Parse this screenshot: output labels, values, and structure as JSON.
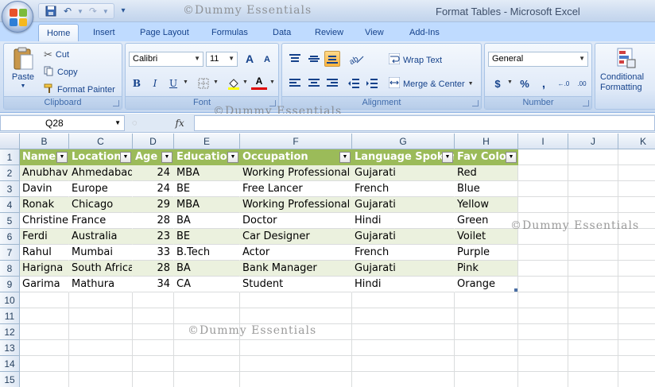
{
  "window": {
    "title": "Format Tables - Microsoft Excel"
  },
  "watermark": "©Dummy Essentials",
  "tabs": [
    "Home",
    "Insert",
    "Page Layout",
    "Formulas",
    "Data",
    "Review",
    "View",
    "Add-Ins"
  ],
  "clipboard": {
    "paste": "Paste",
    "cut": "Cut",
    "copy": "Copy",
    "format_painter": "Format Painter",
    "label": "Clipboard"
  },
  "font": {
    "name": "Calibri",
    "size": "11",
    "bold": "B",
    "italic": "I",
    "underline": "U",
    "grow": "A",
    "shrink": "A",
    "font_color": "A",
    "label": "Font"
  },
  "alignment": {
    "wrap_text": "Wrap Text",
    "merge_center": "Merge & Center",
    "label": "Alignment"
  },
  "number": {
    "format": "General",
    "currency": "$",
    "percent": "%",
    "comma": ",",
    "label": "Number"
  },
  "styles": {
    "conditional_formatting_1": "Conditional",
    "conditional_formatting_2": "Formatting"
  },
  "formula_bar": {
    "name_box": "Q28",
    "fx": "fx",
    "formula": ""
  },
  "columns": [
    "B",
    "C",
    "D",
    "E",
    "F",
    "G",
    "H",
    "I",
    "J",
    "K"
  ],
  "rows": [
    "1",
    "2",
    "3",
    "4",
    "5",
    "6",
    "7",
    "8",
    "9",
    "10",
    "11",
    "12",
    "13",
    "14",
    "15"
  ],
  "table": {
    "headers": [
      "Name",
      "Location",
      "Age",
      "Education",
      "Occupation",
      "Language Spoken",
      "Fav Color"
    ],
    "rows": [
      [
        "Anubhav",
        "Ahmedabad",
        "24",
        "MBA",
        "Working Professional",
        "Gujarati",
        "Red"
      ],
      [
        "Davin",
        "Europe",
        "24",
        "BE",
        "Free Lancer",
        "French",
        "Blue"
      ],
      [
        "Ronak",
        "Chicago",
        "29",
        "MBA",
        "Working Professional",
        "Gujarati",
        "Yellow"
      ],
      [
        "Christine",
        "France",
        "28",
        "BA",
        "Doctor",
        "Hindi",
        "Green"
      ],
      [
        "Ferdi",
        "Australia",
        "23",
        "BE",
        "Car Designer",
        "Gujarati",
        "Voilet"
      ],
      [
        "Rahul",
        "Mumbai",
        "33",
        "B.Tech",
        "Actor",
        "French",
        "Purple"
      ],
      [
        "Harigna",
        "South Africa",
        "28",
        "BA",
        "Bank Manager",
        "Gujarati",
        "Pink"
      ],
      [
        "Garima",
        "Mathura",
        "34",
        "CA",
        "Student",
        "Hindi",
        "Orange"
      ]
    ]
  },
  "colors": {
    "table_header": "#9bbb59",
    "band_row": "#ebf1de",
    "ribbon_text": "#15428b"
  }
}
